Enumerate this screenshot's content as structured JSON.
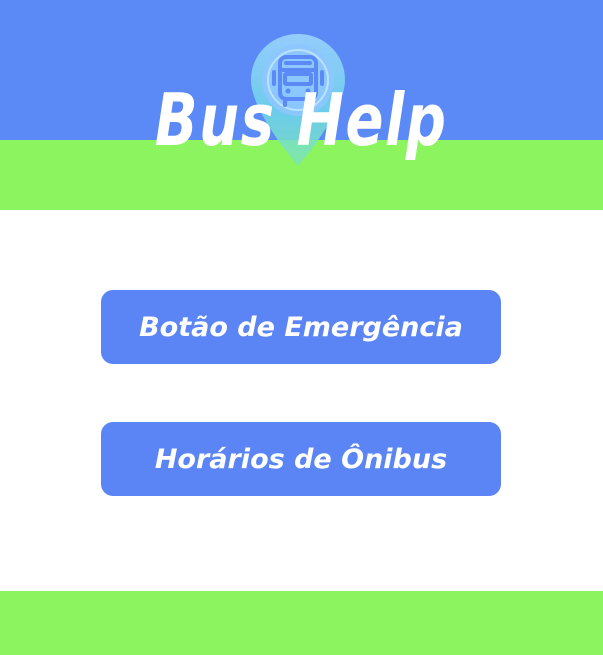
{
  "header": {
    "app_title": "Bus Help",
    "logo_icon": "bus-pin-icon",
    "colors": {
      "blue": "#5b8af7",
      "green": "#8bf45f"
    }
  },
  "main": {
    "emergency_button_label": "Botão de Emergência",
    "schedule_button_label": "Horários de Ônibus",
    "button_color": "#5b85f5"
  }
}
